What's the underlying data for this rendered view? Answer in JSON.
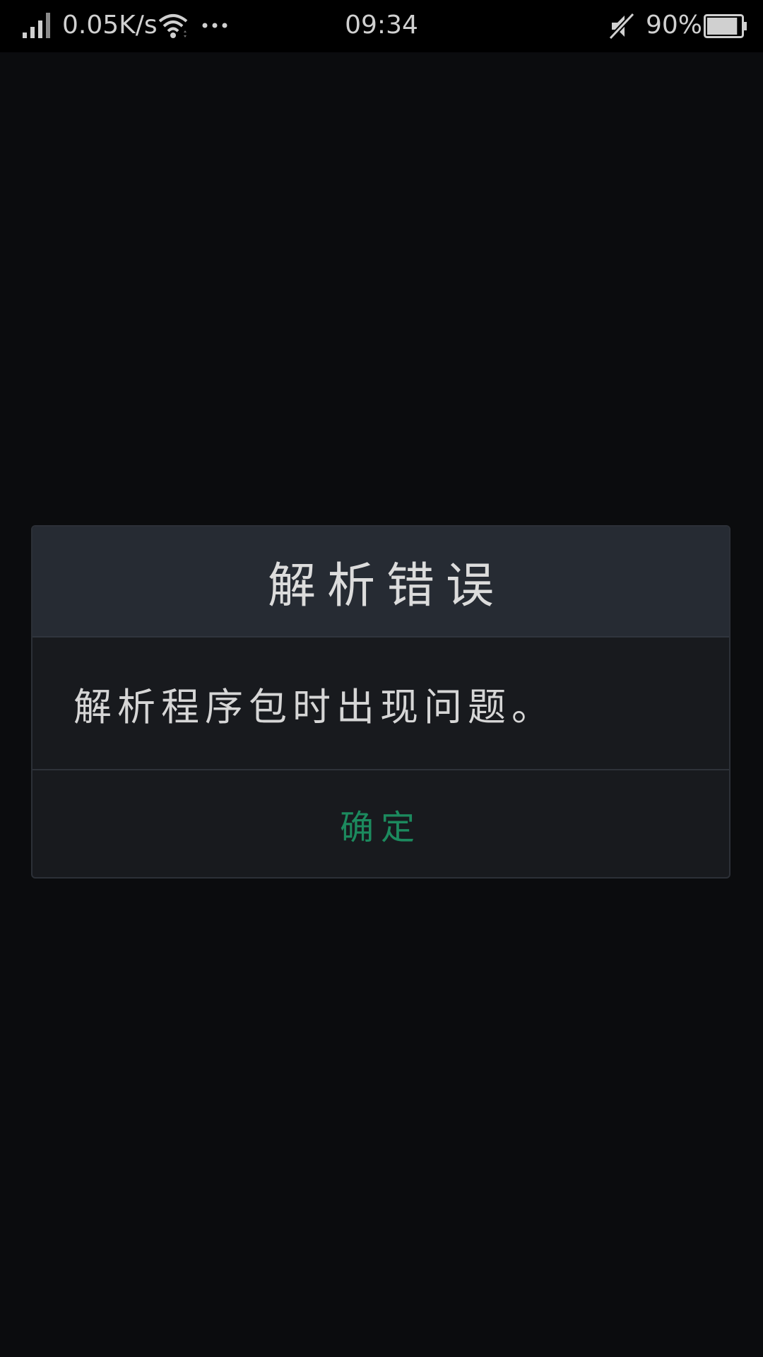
{
  "status_bar": {
    "net_speed": "0.05K/s",
    "time": "09:34",
    "battery_percent": "90%",
    "battery_level": 0.9,
    "icons": {
      "signal": "signal-icon",
      "wifi": "wifi-icon",
      "more": "more-dots-icon",
      "mute": "mute-icon",
      "battery": "battery-icon"
    }
  },
  "dialog": {
    "title": "解析错误",
    "message": "解析程序包时出现问题。",
    "confirm_label": "确定"
  },
  "colors": {
    "background": "#0b0c0e",
    "dialog_header": "#262b33",
    "dialog_body": "#181a1e",
    "accent": "#1c8a5e"
  }
}
